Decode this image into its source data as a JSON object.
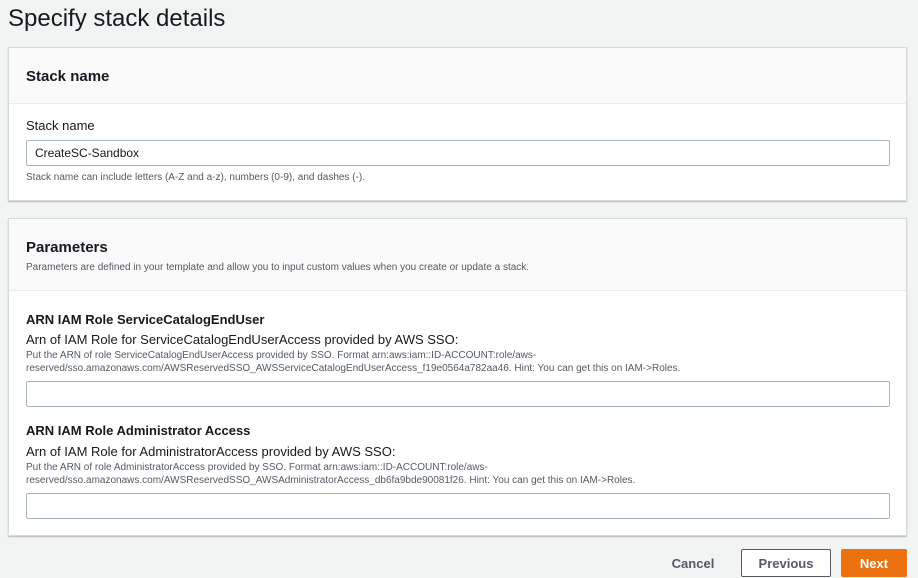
{
  "page": {
    "title": "Specify stack details"
  },
  "stack_name_panel": {
    "header": "Stack name",
    "field_label": "Stack name",
    "field_value": "CreateSC-Sandbox",
    "hint": "Stack name can include letters (A-Z and a-z), numbers (0-9), and dashes (-)."
  },
  "parameters_panel": {
    "header": "Parameters",
    "description": "Parameters are defined in your template and allow you to input custom values when you create or update a stack.",
    "params": [
      {
        "name": "ARN IAM Role ServiceCatalogEndUser",
        "label": "Arn of IAM Role for ServiceCatalogEndUserAccess provided by AWS SSO:",
        "help_line1": "Put the ARN of role ServiceCatalogEndUserAccess provided by SSO. Format arn:aws:iam::ID-ACCOUNT:role/aws-",
        "help_line2": "reserved/sso.amazonaws.com/AWSReservedSSO_AWSServiceCatalogEndUserAccess_f19e0564a782aa46. Hint: You can get this on IAM->Roles.",
        "value": ""
      },
      {
        "name": "ARN IAM Role Administrator Access",
        "label": "Arn of IAM Role for AdministratorAccess provided by AWS SSO:",
        "help_line1": "Put the ARN of role AdministratorAccess provided by SSO. Format arn:aws:iam::ID-ACCOUNT:role/aws-",
        "help_line2": "reserved/sso.amazonaws.com/AWSReservedSSO_AWSAdministratorAccess_db6fa9bde90081f26. Hint: You can get this on IAM->Roles.",
        "value": ""
      }
    ]
  },
  "footer": {
    "cancel_label": "Cancel",
    "previous_label": "Previous",
    "next_label": "Next"
  },
  "colors": {
    "primary": "#ec7211",
    "background": "#f2f3f3",
    "border": "#d5dbdb",
    "text": "#16191f",
    "muted_text": "#545b64"
  }
}
